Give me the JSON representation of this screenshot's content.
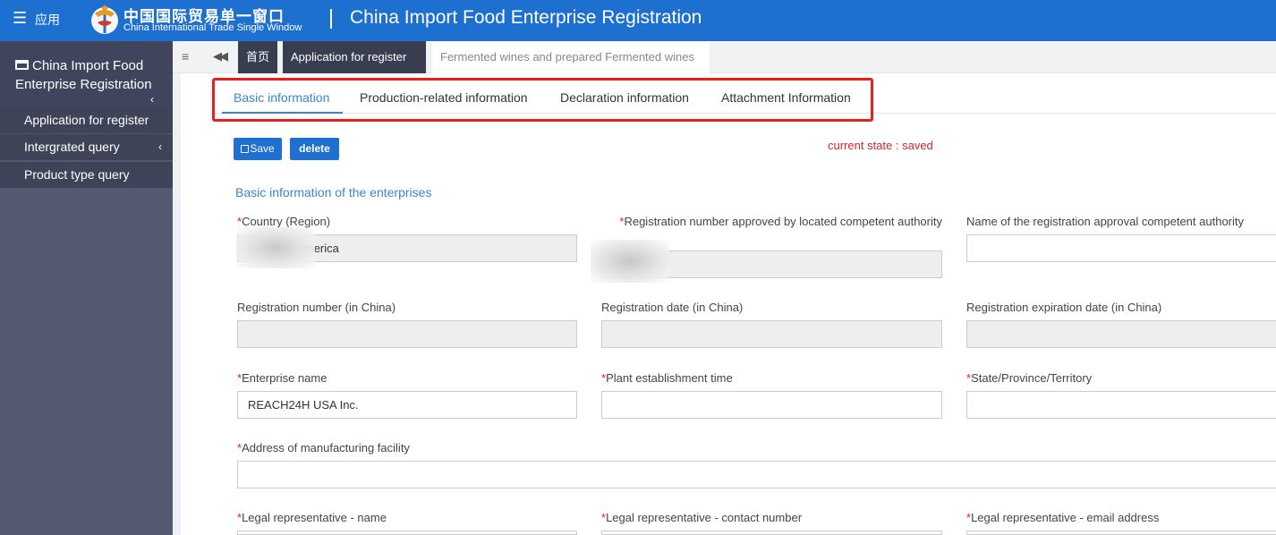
{
  "header": {
    "menu_label": "应用",
    "brand_cn": "中国国际贸易单一窗口",
    "brand_en": "China International Trade Single Window",
    "app_title": "China Import Food Enterprise Registration"
  },
  "sidebar": {
    "title": "China Import Food Enterprise Registration",
    "items": [
      {
        "label": "Application for register"
      },
      {
        "label": "Intergrated query"
      },
      {
        "label": "Product type query"
      }
    ]
  },
  "tabstrip": {
    "tabs": [
      {
        "label": "首页"
      },
      {
        "label": "Application for register"
      },
      {
        "label": "Fermented wines and prepared Fermented wines"
      }
    ]
  },
  "form": {
    "tabs": [
      {
        "label": "Basic information",
        "active": true
      },
      {
        "label": "Production-related information"
      },
      {
        "label": "Declaration information"
      },
      {
        "label": "Attachment Information"
      }
    ],
    "save_label": "Save",
    "delete_label": "delete",
    "state": "current state : saved",
    "section_title": "Basic information of the enterprises",
    "fields": {
      "country": {
        "label": "Country (Region)",
        "value": "States of America"
      },
      "reg_no_approved": {
        "label": "Registration number approved by located competent authority",
        "value": ""
      },
      "approval_authority": {
        "label": "Name of the registration approval competent authority",
        "value": ""
      },
      "reg_no_china": {
        "label": "Registration number (in China)",
        "value": ""
      },
      "reg_date_china": {
        "label": "Registration date (in China)",
        "value": ""
      },
      "reg_exp_china": {
        "label": "Registration expiration date (in China)",
        "value": ""
      },
      "enterprise_name": {
        "label": "Enterprise name",
        "value": "REACH24H USA Inc."
      },
      "plant_time": {
        "label": "Plant establishment time",
        "value": ""
      },
      "state_province": {
        "label": "State/Province/Territory",
        "value": ""
      },
      "address": {
        "label": "Address of manufacturing facility",
        "value": ""
      },
      "legal_name": {
        "label": "Legal representative - name",
        "value": ""
      },
      "legal_phone": {
        "label": "Legal representative - contact number",
        "value": ""
      },
      "legal_email": {
        "label": "Legal representative - email address",
        "value": ""
      }
    }
  },
  "colors": {
    "header_blue": "#1d6fd0",
    "sidebar_bg": "#545871",
    "sidebar_item_bg": "#3f4358",
    "tab_active": "#3a85d6",
    "required_red": "#e8201b",
    "highlight_red": "#e8201b"
  }
}
